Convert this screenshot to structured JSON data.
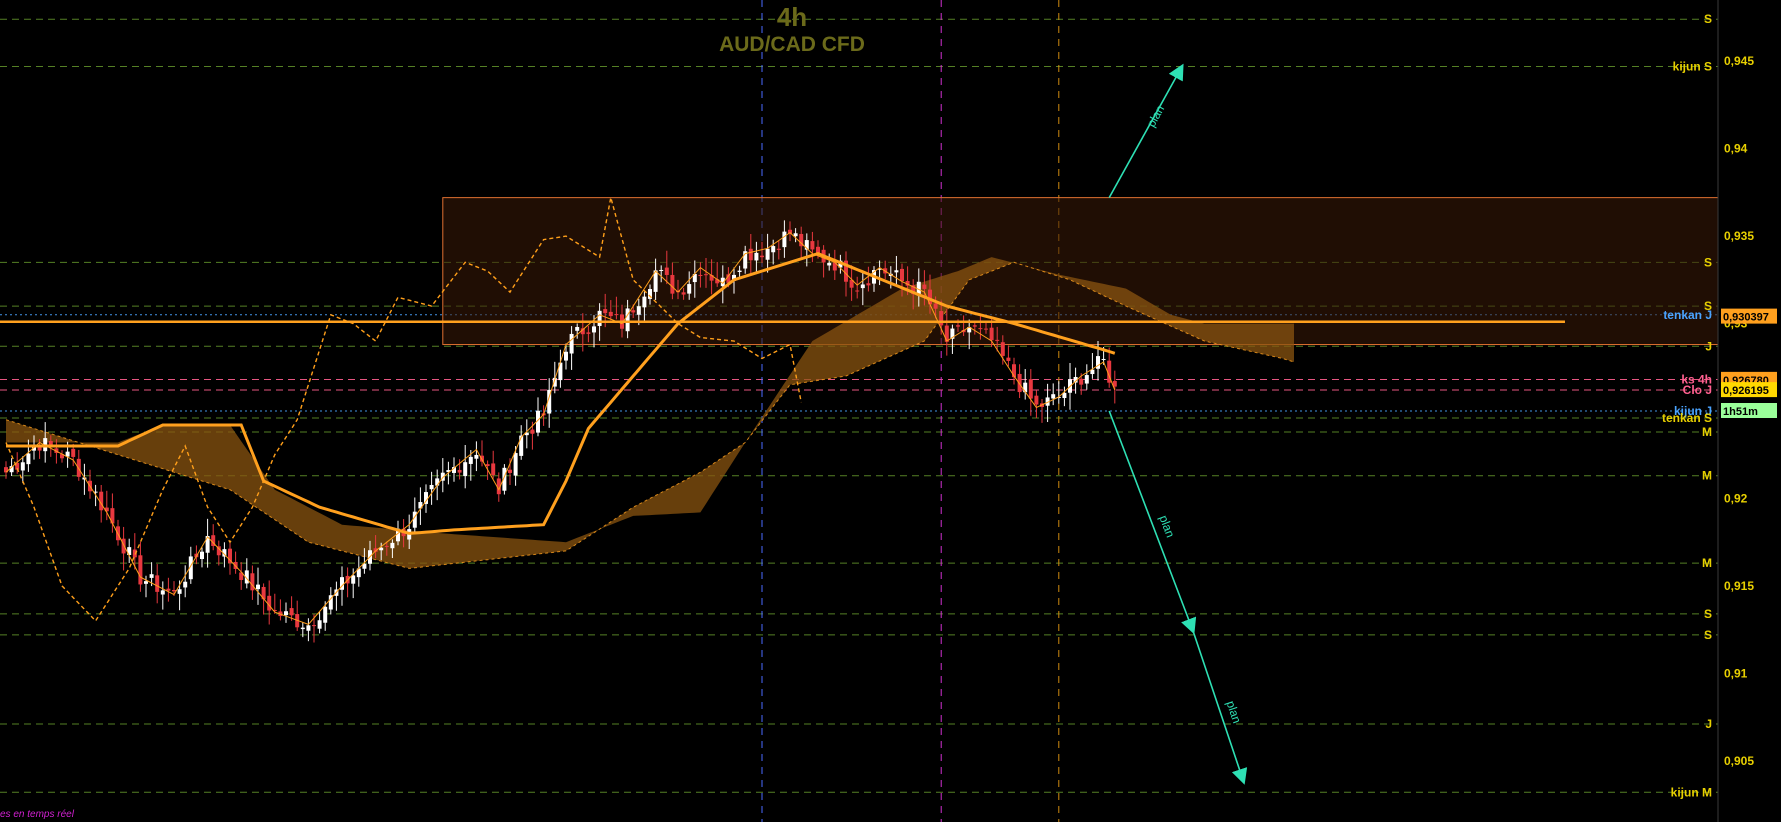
{
  "header": {
    "timeframe": "4h",
    "symbol": "AUD/CAD CFD"
  },
  "footer_text": "es en temps réel",
  "colors": {
    "background": "#000000",
    "bull": "#ffffff",
    "bear": "#e8383f",
    "tenkan": "#ff9f1a",
    "kijun": "#ffa01e",
    "cloud": "#8a5410",
    "plan_arrow": "#2ee0b4",
    "level_yellow": "#e8d000",
    "level_green": "#5f8e2a",
    "level_blue": "#4aa3ff",
    "level_pink": "#ff6090",
    "price_box": "#ffd800"
  },
  "chart_data": {
    "type": "candlestick",
    "ylim": [
      0.9015,
      0.9485
    ],
    "yticks": [
      {
        "value": 0.945,
        "label": "0,945"
      },
      {
        "value": 0.94,
        "label": "0,94"
      },
      {
        "value": 0.935,
        "label": "0,935"
      },
      {
        "value": 0.93,
        "label": "0,93"
      },
      {
        "value": 0.92,
        "label": "0,92"
      },
      {
        "value": 0.915,
        "label": "0,915"
      },
      {
        "value": 0.91,
        "label": "0,91"
      },
      {
        "value": 0.905,
        "label": "0,905"
      }
    ],
    "levels": [
      {
        "value": 0.9474,
        "label": "S",
        "color": "#e8d000",
        "style": "dash",
        "line": "#5f8e2a"
      },
      {
        "value": 0.9447,
        "label": "kijun S",
        "color": "#e8d000",
        "style": "dash",
        "line": "#5f8e2a"
      },
      {
        "value": 0.9335,
        "label": "S",
        "color": "#e8d000",
        "style": "dash",
        "line": "#5f8e2a"
      },
      {
        "value": 0.931,
        "label": "S",
        "color": "#e8d000",
        "style": "dash",
        "line": "#5f8e2a"
      },
      {
        "value": 0.9305,
        "label": "tenkan J",
        "color": "#4aa3ff",
        "style": "dot",
        "line": "#4aa3ff"
      },
      {
        "value": 0.9287,
        "label": "J",
        "color": "#e8d000",
        "style": "dash",
        "line": "#5f8e2a"
      },
      {
        "value": 0.9268,
        "label": "ks 4h",
        "color": "#ff6090",
        "style": "dash",
        "line": "#ff6090"
      },
      {
        "value": 0.9262,
        "label": "Clo J",
        "color": "#ff6090",
        "style": "dash",
        "line": "#ff6090"
      },
      {
        "value": 0.925,
        "label": "kijun J",
        "color": "#4aa3ff",
        "style": "dot",
        "line": "#4aa3ff"
      },
      {
        "value": 0.9246,
        "label": "tenkan S",
        "color": "#e8d000",
        "style": "dash",
        "line": "#5f8e2a"
      },
      {
        "value": 0.9238,
        "label": "M",
        "color": "#e8d000",
        "style": "dash",
        "line": "#5f8e2a"
      },
      {
        "value": 0.9213,
        "label": "M",
        "color": "#e8d000",
        "style": "dash",
        "line": "#5f8e2a"
      },
      {
        "value": 0.9163,
        "label": "M",
        "color": "#e8d000",
        "style": "dash",
        "line": "#5f8e2a"
      },
      {
        "value": 0.9134,
        "label": "S",
        "color": "#e8d000",
        "style": "dash",
        "line": "#5f8e2a"
      },
      {
        "value": 0.9122,
        "label": "S",
        "color": "#e8d000",
        "style": "dash",
        "line": "#5f8e2a"
      },
      {
        "value": 0.9071,
        "label": "J",
        "color": "#e8d000",
        "style": "dash",
        "line": "#5f8e2a"
      },
      {
        "value": 0.9032,
        "label": "kijun M",
        "color": "#e8d000",
        "style": "dash",
        "line": "#5f8e2a"
      }
    ],
    "price_tags": [
      {
        "value": 0.930397,
        "label": "0,930397",
        "bg": "#ffa01e",
        "fg": "#000000"
      },
      {
        "value": 0.92678,
        "label": "0,926780",
        "bg": "#ffa01e",
        "fg": "#000000"
      },
      {
        "value": 0.926195,
        "label": "0,926195",
        "bg": "#ffd800",
        "fg": "#000000"
      },
      {
        "value": 0.925,
        "label": "1h51m",
        "bg": "#9aff9a",
        "fg": "#000000"
      }
    ],
    "horizontal_line": {
      "value": 0.9301
    },
    "rectangle": {
      "start_bar": 78,
      "end_bar": 270,
      "top": 0.9372,
      "bottom": 0.9288
    },
    "vlines": [
      {
        "bar": 135,
        "color": "#4a6aff"
      },
      {
        "bar": 167,
        "color": "#d030d0"
      },
      {
        "bar": 188,
        "color": "#d08a10"
      }
    ],
    "plan_arrows": [
      {
        "label": "plan",
        "from": [
          197,
          0.9372
        ],
        "to": [
          210,
          0.9447
        ]
      },
      {
        "label": "plan",
        "from": [
          197,
          0.925
        ],
        "to": [
          212,
          0.9124
        ]
      },
      {
        "label": "plan",
        "to2": [
          221,
          0.9038
        ]
      }
    ],
    "close_anchors": [
      [
        0,
        0.9215
      ],
      [
        6,
        0.9232
      ],
      [
        12,
        0.9222
      ],
      [
        18,
        0.9192
      ],
      [
        24,
        0.9155
      ],
      [
        30,
        0.9145
      ],
      [
        36,
        0.9178
      ],
      [
        42,
        0.9158
      ],
      [
        48,
        0.9135
      ],
      [
        54,
        0.9128
      ],
      [
        60,
        0.915
      ],
      [
        66,
        0.917
      ],
      [
        72,
        0.9185
      ],
      [
        78,
        0.9212
      ],
      [
        84,
        0.9228
      ],
      [
        88,
        0.9205
      ],
      [
        92,
        0.9235
      ],
      [
        96,
        0.9248
      ],
      [
        100,
        0.9288
      ],
      [
        106,
        0.9305
      ],
      [
        110,
        0.93
      ],
      [
        116,
        0.933
      ],
      [
        120,
        0.9318
      ],
      [
        124,
        0.9332
      ],
      [
        128,
        0.9323
      ],
      [
        132,
        0.934
      ],
      [
        136,
        0.9343
      ],
      [
        140,
        0.9352
      ],
      [
        144,
        0.934
      ],
      [
        148,
        0.9335
      ],
      [
        152,
        0.9322
      ],
      [
        156,
        0.9332
      ],
      [
        160,
        0.9324
      ],
      [
        164,
        0.9318
      ],
      [
        168,
        0.929
      ],
      [
        172,
        0.9298
      ],
      [
        176,
        0.929
      ],
      [
        180,
        0.927
      ],
      [
        184,
        0.9252
      ],
      [
        188,
        0.9258
      ],
      [
        192,
        0.927
      ],
      [
        196,
        0.9278
      ],
      [
        198,
        0.9262
      ]
    ],
    "kijun_anchors": [
      [
        0,
        0.923
      ],
      [
        20,
        0.923
      ],
      [
        28,
        0.9242
      ],
      [
        42,
        0.9242
      ],
      [
        46,
        0.921
      ],
      [
        56,
        0.9195
      ],
      [
        72,
        0.918
      ],
      [
        80,
        0.9182
      ],
      [
        96,
        0.9185
      ],
      [
        100,
        0.921
      ],
      [
        104,
        0.924
      ],
      [
        120,
        0.93
      ],
      [
        130,
        0.9325
      ],
      [
        145,
        0.934
      ],
      [
        168,
        0.931
      ],
      [
        180,
        0.93
      ],
      [
        196,
        0.9285
      ],
      [
        198,
        0.9283
      ]
    ],
    "kumo_a": [
      [
        0,
        0.9232
      ],
      [
        20,
        0.9232
      ],
      [
        28,
        0.9242
      ],
      [
        40,
        0.9242
      ],
      [
        48,
        0.9205
      ],
      [
        60,
        0.9185
      ],
      [
        78,
        0.918
      ],
      [
        100,
        0.9175
      ],
      [
        112,
        0.919
      ],
      [
        124,
        0.9192
      ],
      [
        132,
        0.9232
      ],
      [
        144,
        0.929
      ],
      [
        160,
        0.932
      ],
      [
        170,
        0.933
      ],
      [
        176,
        0.9338
      ],
      [
        188,
        0.9328
      ],
      [
        200,
        0.932
      ],
      [
        208,
        0.9305
      ],
      [
        214,
        0.93
      ],
      [
        230,
        0.93
      ]
    ],
    "kumo_b": [
      [
        0,
        0.9245
      ],
      [
        20,
        0.9225
      ],
      [
        30,
        0.9215
      ],
      [
        40,
        0.9205
      ],
      [
        54,
        0.9175
      ],
      [
        72,
        0.916
      ],
      [
        100,
        0.917
      ],
      [
        112,
        0.9195
      ],
      [
        124,
        0.9215
      ],
      [
        132,
        0.9232
      ],
      [
        140,
        0.9265
      ],
      [
        150,
        0.927
      ],
      [
        164,
        0.929
      ],
      [
        172,
        0.9325
      ],
      [
        180,
        0.9335
      ],
      [
        190,
        0.9325
      ],
      [
        200,
        0.931
      ],
      [
        214,
        0.929
      ],
      [
        228,
        0.928
      ],
      [
        230,
        0.9278
      ]
    ],
    "chikou_anchors": [
      [
        0,
        0.9232
      ],
      [
        5,
        0.9195
      ],
      [
        10,
        0.915
      ],
      [
        16,
        0.913
      ],
      [
        22,
        0.916
      ],
      [
        28,
        0.9205
      ],
      [
        32,
        0.923
      ],
      [
        36,
        0.9195
      ],
      [
        40,
        0.9175
      ],
      [
        44,
        0.9195
      ],
      [
        48,
        0.9225
      ],
      [
        52,
        0.9245
      ],
      [
        56,
        0.9285
      ],
      [
        58,
        0.9305
      ],
      [
        62,
        0.93
      ],
      [
        66,
        0.929
      ],
      [
        70,
        0.9315
      ],
      [
        76,
        0.931
      ],
      [
        82,
        0.9335
      ],
      [
        86,
        0.933
      ],
      [
        90,
        0.9318
      ],
      [
        96,
        0.9348
      ],
      [
        100,
        0.935
      ],
      [
        106,
        0.9338
      ],
      [
        108,
        0.9372
      ],
      [
        112,
        0.9325
      ],
      [
        120,
        0.93
      ],
      [
        124,
        0.9292
      ],
      [
        130,
        0.929
      ],
      [
        135,
        0.928
      ],
      [
        140,
        0.9288
      ],
      [
        142,
        0.9255
      ]
    ]
  }
}
